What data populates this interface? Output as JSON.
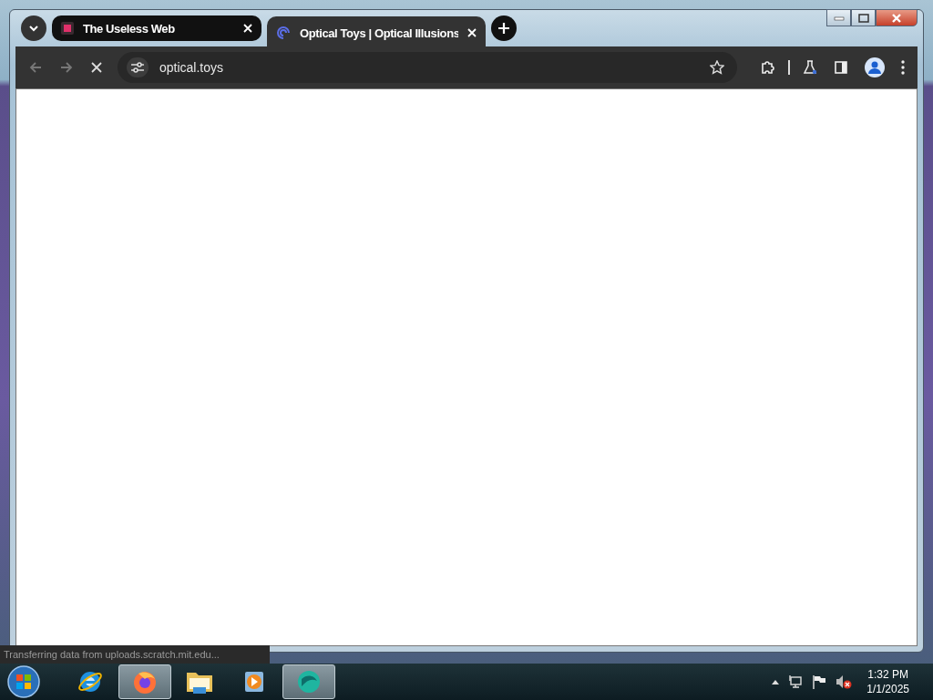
{
  "browser": {
    "tabs": [
      {
        "title": "The Useless Web",
        "selected": false,
        "kind": "square"
      },
      {
        "title": "Optical Toys | Optical Illusions",
        "selected": true,
        "kind": "spiral"
      }
    ],
    "toolbar": {
      "loading": true,
      "address": "optical.toys"
    },
    "status": "Transferring data from uploads.scratch.mit.edu..."
  },
  "taskbar": {
    "apps": [
      {
        "kind": "ie",
        "running": false
      },
      {
        "kind": "firefox",
        "running": true
      },
      {
        "kind": "folder",
        "running": false
      },
      {
        "kind": "media",
        "running": false
      },
      {
        "kind": "disc",
        "running": true
      }
    ],
    "clock": {
      "time": "1:32 PM",
      "date": "1/1/2025"
    }
  }
}
